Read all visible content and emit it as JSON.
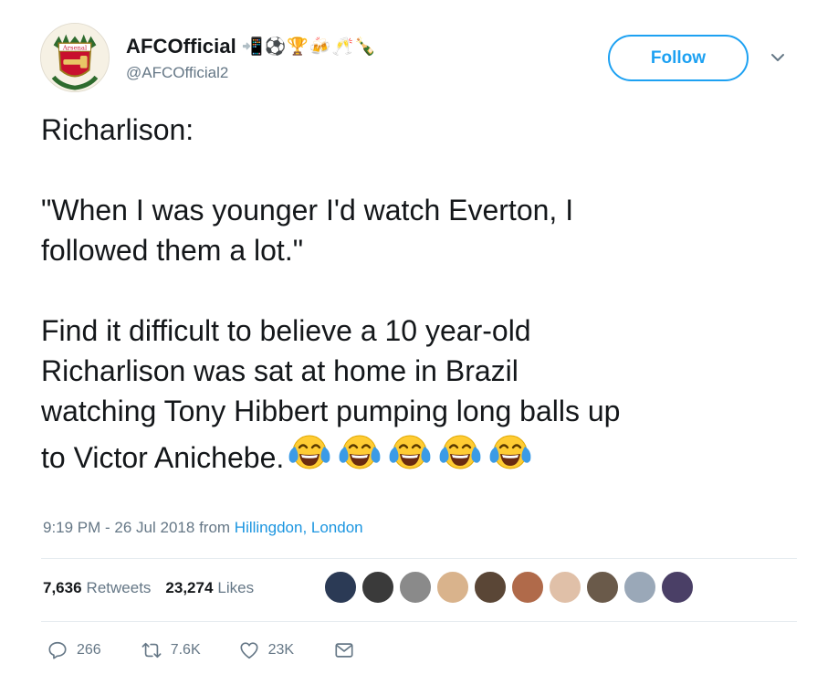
{
  "user": {
    "display_name": "AFCOfficial",
    "handle": "@AFCOfficial2",
    "avatar_text": "Arsenal",
    "name_emojis": [
      "📲",
      "⚽",
      "🏆",
      "🍻",
      "🥂",
      "🍾"
    ]
  },
  "follow_label": "Follow",
  "tweet": {
    "line1": "Richarlison:",
    "line2": "\"When I was younger I'd watch Everton, I",
    "line3": "followed them a lot.\"",
    "line4": "Find it difficult to believe a 10 year-old",
    "line5": "Richarlison was sat at home in Brazil",
    "line6": "watching Tony Hibbert pumping long balls up",
    "line7": "to Victor Anichebe.",
    "emoji": "face-with-tears-of-joy",
    "emoji_count": 5
  },
  "meta": {
    "timestamp": "9:19 PM - 26 Jul 2018",
    "from_label": "from",
    "location": "Hillingdon, London"
  },
  "stats": {
    "retweets_count": "7,636",
    "retweets_label": "Retweets",
    "likes_count": "23,274",
    "likes_label": "Likes"
  },
  "likers": [
    "#2b3a55",
    "#3a3a3a",
    "#8a8a8a",
    "#d9b38c",
    "#5a4636",
    "#b06a4a",
    "#e0c0a8",
    "#6a5a4a",
    "#9aa8b8",
    "#4a3f66"
  ],
  "actions": {
    "reply_count": "266",
    "retweet_count": "7.6K",
    "like_count": "23K"
  },
  "colors": {
    "accent": "#1da1f2",
    "link": "#1b95e0",
    "muted": "#657786",
    "text": "#14171a"
  }
}
